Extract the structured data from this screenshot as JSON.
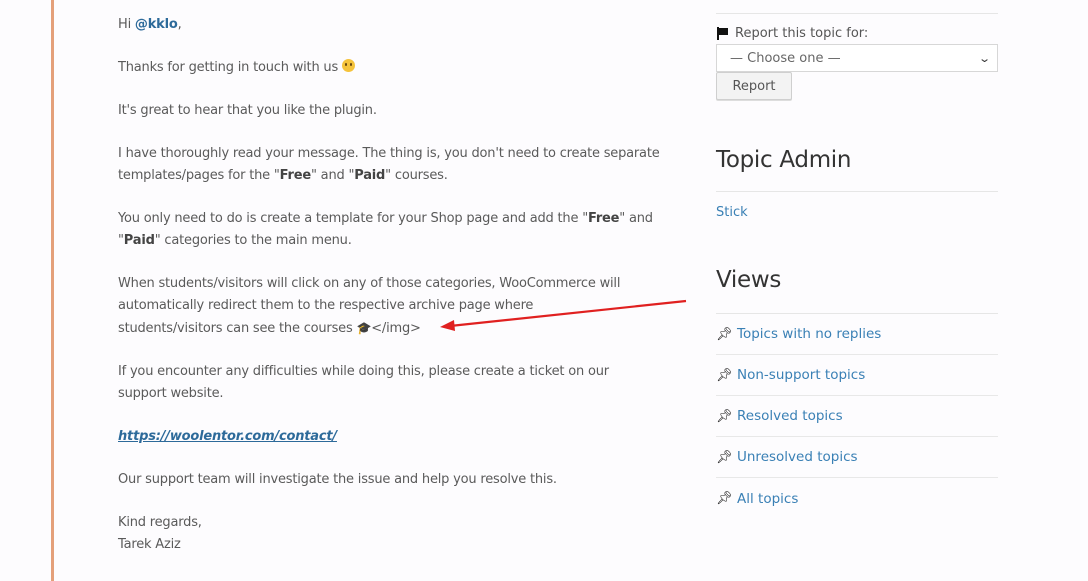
{
  "post": {
    "greeting_prefix": "Hi ",
    "mention": "@kklo",
    "greeting_suffix": ",",
    "thanks": "Thanks for getting in touch with us",
    "thanks_emoji": "smiley-emoji",
    "great": "It's great to hear that you like the plugin.",
    "p3_a": "I have thoroughly read your message. The thing is, you don't need to create separate templates/pages for the \"",
    "free": "Free",
    "p3_b": "\" and \"",
    "paid": "Paid",
    "p3_c": "\" courses.",
    "p4_a": "You only need to do is create a template for your Shop page and add the \"",
    "p4_b": "\" and \"",
    "p4_c": "\" categories to the main menu.",
    "p5_line1": "When students/visitors will click on any of those categories, WooCommerce will",
    "p5_line2": "automatically redirect them to the respective archive page where",
    "p5_line3": "students/visitors can see the courses ",
    "p5_glyph": "🎓",
    "p5_tag": "</img>",
    "p6": "If you encounter any difficulties while doing this, please create a ticket on our support website.",
    "link": "https://woolentor.com/contact/",
    "p7": "Our support team will investigate the issue and help you resolve this.",
    "signoff": "Kind regards,",
    "signature": "Tarek Aziz"
  },
  "annotation": {
    "arrow_color": "#e02020"
  },
  "sidebar": {
    "report_label": "Report this topic for:",
    "report_select_value": "— Choose one —",
    "report_button": "Report",
    "topic_admin_title": "Topic Admin",
    "stick_link": "Stick",
    "views_title": "Views",
    "views": [
      {
        "label": "Topics with no replies"
      },
      {
        "label": "Non-support topics"
      },
      {
        "label": "Resolved topics"
      },
      {
        "label": "Unresolved topics"
      },
      {
        "label": "All topics"
      }
    ]
  },
  "colors": {
    "accent_border": "#e4a07a",
    "link": "#3a80b5"
  }
}
